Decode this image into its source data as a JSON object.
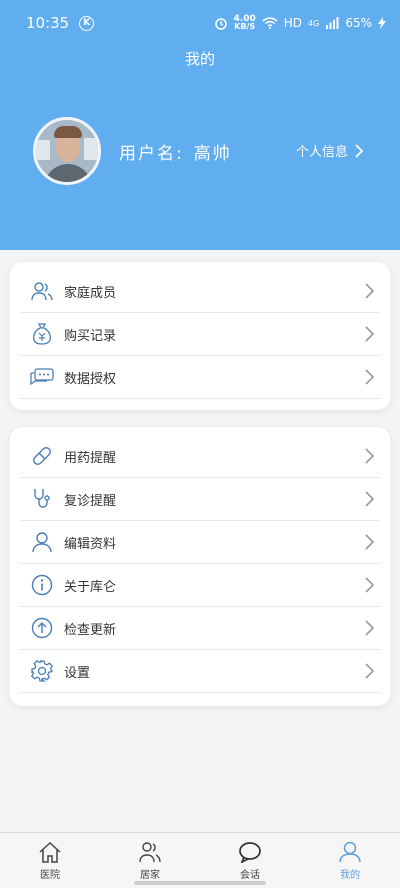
{
  "status": {
    "time": "10:35",
    "net_speed": "4.00",
    "net_unit": "KB/S",
    "hd": "HD",
    "signal": "4G",
    "battery": "65%"
  },
  "page_title": "我的",
  "user": {
    "name_label": "用户名:",
    "name": "高帅",
    "profile_link": "个人信息"
  },
  "menu_group1": [
    {
      "label": "家庭成员",
      "icon": "family-icon"
    },
    {
      "label": "购买记录",
      "icon": "money-bag-icon"
    },
    {
      "label": "数据授权",
      "icon": "message-icon"
    }
  ],
  "menu_group2": [
    {
      "label": "用药提醒",
      "icon": "pill-icon"
    },
    {
      "label": "复诊提醒",
      "icon": "stethoscope-icon"
    },
    {
      "label": "编辑资料",
      "icon": "user-icon"
    },
    {
      "label": "关于库仑",
      "icon": "info-icon"
    },
    {
      "label": "检查更新",
      "icon": "arrow-up-icon"
    },
    {
      "label": "设置",
      "icon": "gear-icon"
    }
  ],
  "tabs": [
    {
      "label": "医院",
      "icon": "home-icon"
    },
    {
      "label": "居家",
      "icon": "people-icon"
    },
    {
      "label": "会话",
      "icon": "chat-icon"
    },
    {
      "label": "我的",
      "icon": "person-icon"
    }
  ],
  "colors": {
    "header": "#60adef",
    "accent": "#5a9fe0",
    "icon": "#4a7fb5"
  }
}
